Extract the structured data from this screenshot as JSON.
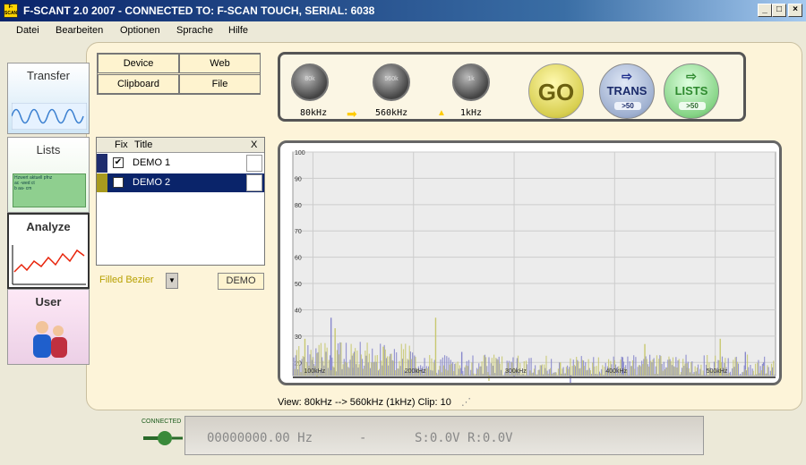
{
  "window": {
    "title": "F-SCANT 2.0 2007 - CONNECTED TO: F-SCAN TOUCH, SERIAL: 6038",
    "icon_text": "F-SCAN",
    "min_glyph": "_",
    "max_glyph": "□",
    "close_glyph": "×"
  },
  "menu": [
    "Datei",
    "Bearbeiten",
    "Optionen",
    "Sprache",
    "Hilfe"
  ],
  "nav": {
    "transfer": "Transfer",
    "lists": "Lists",
    "analyze": "Analyze",
    "user": "User",
    "lists_thumb": [
      "Hzwert",
      "aktuell",
      "pfnz",
      "ac",
      "-wed",
      "ct",
      "b",
      "aa-",
      "cm"
    ]
  },
  "grid_buttons": {
    "device": "Device",
    "web": "Web",
    "clipboard": "Clipboard",
    "file": "File"
  },
  "table": {
    "col_fix": "Fix",
    "col_title": "Title",
    "col_close": "X",
    "rows": [
      {
        "title": "DEMO 1",
        "checked": "✔",
        "color": "#1f2d6e"
      },
      {
        "title": "DEMO 2",
        "checked": "",
        "color": "#a89a1e"
      }
    ]
  },
  "render_select": "Filled Bezier",
  "select_arrow": "▼",
  "demo_button": "DEMO",
  "controls": {
    "knob1_text": "80k",
    "knob1_label": "80kHz",
    "knob2_text": "560k",
    "knob2_label": "560kHz",
    "knob3_text": "1k",
    "knob3_label": "1kHz",
    "go": "GO",
    "trans": "TRANS",
    "trans_sub": ">50",
    "lists": "LISTS",
    "lists_sub": ">50",
    "arrow_right": "➡",
    "arrow_up": "▲",
    "trans_arrow": "⇨"
  },
  "chart_data": {
    "type": "bar",
    "ylim": [
      0,
      100
    ],
    "yticks": [
      "100",
      "90",
      "80",
      "70",
      "60",
      "50",
      "40",
      "30",
      "20"
    ],
    "xticks": [
      "100kHz",
      "200kHz",
      "300kHz",
      "400kHz",
      "500kHz"
    ],
    "x_range_khz": [
      80,
      560
    ],
    "grid": true,
    "series": [
      {
        "color": "#8888cc",
        "peaks": [
          [
            100,
            22
          ],
          [
            118,
            37
          ],
          [
            140,
            18
          ],
          [
            196,
            16
          ],
          [
            248,
            24
          ],
          [
            300,
            14
          ],
          [
            356,
            12
          ],
          [
            408,
            22
          ],
          [
            472,
            18
          ],
          [
            530,
            24
          ],
          [
            548,
            20
          ]
        ]
      },
      {
        "color": "#c8c870",
        "peaks": [
          [
            92,
            29
          ],
          [
            104,
            14
          ],
          [
            122,
            33
          ],
          [
            170,
            26
          ],
          [
            222,
            37
          ],
          [
            275,
            13
          ],
          [
            346,
            20
          ],
          [
            430,
            27
          ],
          [
            505,
            29
          ],
          [
            553,
            15
          ]
        ]
      }
    ]
  },
  "status": "View: 80kHz --> 560kHz (1kHz)  Clip: 10",
  "connection": {
    "label": "CONNECTED",
    "frequency": "00000000.00 Hz",
    "dash": "-",
    "values": "S:0.0V R:0.0V"
  }
}
